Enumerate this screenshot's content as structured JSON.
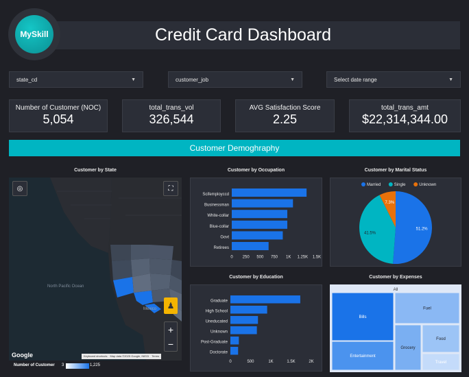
{
  "header": {
    "logo_text": "MySkill",
    "title": "Credit Card Dashboard"
  },
  "filters": [
    {
      "label": "state_cd"
    },
    {
      "label": "customer_job"
    },
    {
      "label": "Select date range"
    }
  ],
  "kpis": [
    {
      "label": "Number of Customer (NOC)",
      "value": "5,054"
    },
    {
      "label": "total_trans_vol",
      "value": "326,544"
    },
    {
      "label": "AVG Satisfaction Score",
      "value": "2.25"
    },
    {
      "label": "total_trans_amt",
      "value": "$22,314,344.00"
    }
  ],
  "section_title": "Customer Demoghraphy",
  "map": {
    "title": "Customer by State",
    "google_label": "Google",
    "attribution": [
      "Keyboard shortcuts",
      "Map data ©2025 Google, INEGI",
      "Terms"
    ],
    "ocean_label": "North Pacific Ocean",
    "mexico_label": "Mexico",
    "legend_label": "Number of Customer",
    "legend_min": "3",
    "legend_max": "1,225",
    "zoom_in": "+",
    "zoom_out": "−"
  },
  "colors": {
    "accent": "#00b5c2",
    "bar": "#1a73e8",
    "bg": "#1f2026",
    "panel": "#2b2e37"
  },
  "chart_data": [
    {
      "type": "bar",
      "title": "Customer by Occupation",
      "orientation": "horizontal",
      "categories": [
        "Scifemployccd",
        "Businessman",
        "White-collar",
        "Blue-collar",
        "Govt",
        "Retirees"
      ],
      "values": [
        1320,
        1080,
        980,
        980,
        900,
        650
      ],
      "xticks": [
        "0",
        "250",
        "500",
        "750",
        "1K",
        "1.25K",
        "1.5K"
      ],
      "xlim": [
        0,
        1500
      ]
    },
    {
      "type": "pie",
      "title": "Customer by Marital Status",
      "categories": [
        "Married",
        "Single",
        "Unknown"
      ],
      "values": [
        51.2,
        41.5,
        7.3
      ],
      "labels": [
        "51.2%",
        "41.5%",
        "7.3%"
      ],
      "colors": [
        "#1a73e8",
        "#00b5c2",
        "#e8710a"
      ],
      "legend": "top"
    },
    {
      "type": "bar",
      "title": "Customer by Education",
      "orientation": "horizontal",
      "categories": [
        "Graduate",
        "High School",
        "Uneducated",
        "Unknown",
        "Post-Graduate",
        "Doctorate"
      ],
      "values": [
        1900,
        1000,
        750,
        720,
        230,
        210
      ],
      "xticks": [
        "0",
        "500",
        "1K",
        "1.5K",
        "2K"
      ],
      "xlim": [
        0,
        2200
      ]
    },
    {
      "type": "treemap",
      "title": "Customer by Expenses",
      "root": "All",
      "categories": [
        "Bills",
        "Entertainment",
        "Grocery",
        "Fuel",
        "Food",
        "Travel"
      ],
      "colors": [
        "#1a73e8",
        "#4b93ee",
        "#7aaff2",
        "#8ab8f4",
        "#9cc4f6",
        "#c4dbfa"
      ]
    }
  ]
}
